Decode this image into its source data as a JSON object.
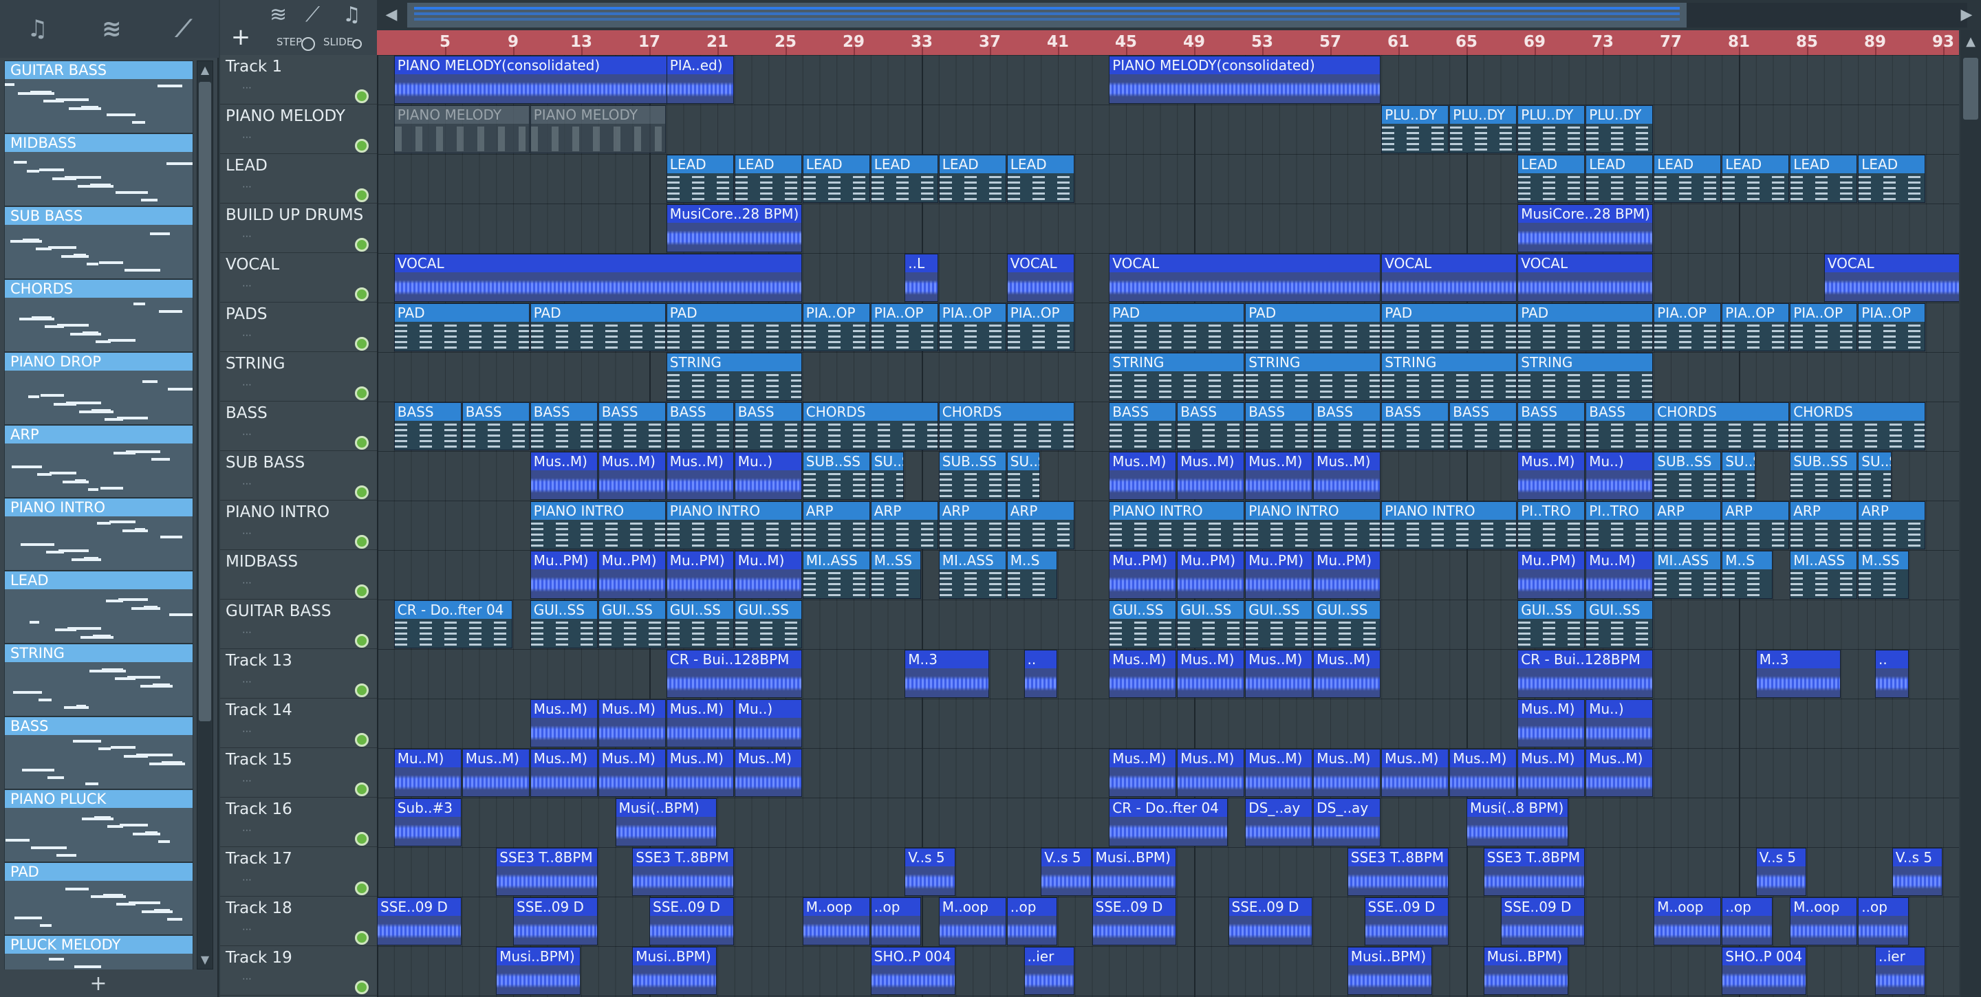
{
  "browser": {
    "icons": {
      "piano": "piano-roll-icon",
      "wave": "audio-clip-icon",
      "link": "automation-icon"
    },
    "add_label": "+",
    "clips": [
      "GUITAR BASS",
      "MIDBASS",
      "SUB BASS",
      "CHORDS",
      "PIANO DROP",
      "ARP",
      "PIANO INTRO",
      "LEAD",
      "STRING",
      "BASS",
      "PIANO PLUCK",
      "PAD",
      "PLUCK MELODY"
    ]
  },
  "toolbar": {
    "add_label": "+",
    "step_label": "STEP",
    "slide_label": "SLIDE"
  },
  "ruler": {
    "bars": [
      "5",
      "9",
      "13",
      "17",
      "21",
      "25",
      "29",
      "33",
      "37",
      "41",
      "45",
      "49",
      "53",
      "57",
      "61",
      "65",
      "69",
      "73",
      "77",
      "81",
      "85",
      "89",
      "93"
    ]
  },
  "tracks": [
    "Track 1",
    "PIANO MELODY",
    "LEAD",
    "BUILD UP DRUMS",
    "VOCAL",
    "PADS",
    "STRING",
    "BASS",
    "SUB BASS",
    "PIANO INTRO",
    "MIDBASS",
    "GUITAR BASS",
    "Track 13",
    "Track 14",
    "Track 15",
    "Track 16",
    "Track 17",
    "Track 18",
    "Track 19"
  ],
  "clips": [
    {
      "t": 0,
      "s": 1,
      "l": 20,
      "k": "a",
      "n": "PIANO MELODY(consolidated)"
    },
    {
      "t": 0,
      "s": 17,
      "l": 4,
      "k": "a",
      "n": "PIA..ed)"
    },
    {
      "t": 0,
      "s": 43,
      "l": 16,
      "k": "a",
      "n": "PIANO MELODY(consolidated)"
    },
    {
      "t": 1,
      "s": 1,
      "l": 8,
      "k": "m",
      "n": "PIANO MELODY"
    },
    {
      "t": 1,
      "s": 9,
      "l": 8,
      "k": "m",
      "n": "PIANO MELODY"
    },
    {
      "t": 1,
      "s": 59,
      "l": 4,
      "k": "p",
      "n": "PLU..DY"
    },
    {
      "t": 1,
      "s": 63,
      "l": 4,
      "k": "p",
      "n": "PLU..DY"
    },
    {
      "t": 1,
      "s": 67,
      "l": 4,
      "k": "p",
      "n": "PLU..DY"
    },
    {
      "t": 1,
      "s": 71,
      "l": 4,
      "k": "p",
      "n": "PLU..DY"
    },
    {
      "t": 2,
      "s": 17,
      "l": 4,
      "k": "p",
      "n": "LEAD"
    },
    {
      "t": 2,
      "s": 21,
      "l": 4,
      "k": "p",
      "n": "LEAD"
    },
    {
      "t": 2,
      "s": 25,
      "l": 4,
      "k": "p",
      "n": "LEAD"
    },
    {
      "t": 2,
      "s": 29,
      "l": 4,
      "k": "p",
      "n": "LEAD"
    },
    {
      "t": 2,
      "s": 33,
      "l": 4,
      "k": "p",
      "n": "LEAD"
    },
    {
      "t": 2,
      "s": 37,
      "l": 4,
      "k": "p",
      "n": "LEAD"
    },
    {
      "t": 2,
      "s": 67,
      "l": 4,
      "k": "p",
      "n": "LEAD"
    },
    {
      "t": 2,
      "s": 71,
      "l": 4,
      "k": "p",
      "n": "LEAD"
    },
    {
      "t": 2,
      "s": 75,
      "l": 4,
      "k": "p",
      "n": "LEAD"
    },
    {
      "t": 2,
      "s": 79,
      "l": 4,
      "k": "p",
      "n": "LEAD"
    },
    {
      "t": 2,
      "s": 83,
      "l": 4,
      "k": "p",
      "n": "LEAD"
    },
    {
      "t": 2,
      "s": 87,
      "l": 4,
      "k": "p",
      "n": "LEAD"
    },
    {
      "t": 3,
      "s": 17,
      "l": 8,
      "k": "a",
      "n": "MusiCore..28 BPM)"
    },
    {
      "t": 3,
      "s": 67,
      "l": 8,
      "k": "a",
      "n": "MusiCore..28 BPM)"
    },
    {
      "t": 4,
      "s": 1,
      "l": 24,
      "k": "a",
      "n": "VOCAL"
    },
    {
      "t": 4,
      "s": 31,
      "l": 2,
      "k": "a",
      "n": "..L"
    },
    {
      "t": 4,
      "s": 37,
      "l": 4,
      "k": "a",
      "n": "VOCAL"
    },
    {
      "t": 4,
      "s": 43,
      "l": 16,
      "k": "a",
      "n": "VOCAL"
    },
    {
      "t": 4,
      "s": 59,
      "l": 8,
      "k": "a",
      "n": "VOCAL"
    },
    {
      "t": 4,
      "s": 67,
      "l": 8,
      "k": "a",
      "n": "VOCAL"
    },
    {
      "t": 4,
      "s": 85,
      "l": 8,
      "k": "a",
      "n": "VOCAL"
    },
    {
      "t": 5,
      "s": 1,
      "l": 8,
      "k": "p",
      "n": "PAD"
    },
    {
      "t": 5,
      "s": 9,
      "l": 8,
      "k": "p",
      "n": "PAD"
    },
    {
      "t": 5,
      "s": 17,
      "l": 8,
      "k": "p",
      "n": "PAD"
    },
    {
      "t": 5,
      "s": 25,
      "l": 4,
      "k": "p",
      "n": "PIA..OP"
    },
    {
      "t": 5,
      "s": 29,
      "l": 4,
      "k": "p",
      "n": "PIA..OP"
    },
    {
      "t": 5,
      "s": 33,
      "l": 4,
      "k": "p",
      "n": "PIA..OP"
    },
    {
      "t": 5,
      "s": 37,
      "l": 4,
      "k": "p",
      "n": "PIA..OP"
    },
    {
      "t": 5,
      "s": 43,
      "l": 8,
      "k": "p",
      "n": "PAD"
    },
    {
      "t": 5,
      "s": 51,
      "l": 8,
      "k": "p",
      "n": "PAD"
    },
    {
      "t": 5,
      "s": 59,
      "l": 8,
      "k": "p",
      "n": "PAD"
    },
    {
      "t": 5,
      "s": 67,
      "l": 8,
      "k": "p",
      "n": "PAD"
    },
    {
      "t": 5,
      "s": 75,
      "l": 4,
      "k": "p",
      "n": "PIA..OP"
    },
    {
      "t": 5,
      "s": 79,
      "l": 4,
      "k": "p",
      "n": "PIA..OP"
    },
    {
      "t": 5,
      "s": 83,
      "l": 4,
      "k": "p",
      "n": "PIA..OP"
    },
    {
      "t": 5,
      "s": 87,
      "l": 4,
      "k": "p",
      "n": "PIA..OP"
    },
    {
      "t": 6,
      "s": 17,
      "l": 8,
      "k": "p",
      "n": "STRING"
    },
    {
      "t": 6,
      "s": 43,
      "l": 8,
      "k": "p",
      "n": "STRING"
    },
    {
      "t": 6,
      "s": 51,
      "l": 8,
      "k": "p",
      "n": "STRING"
    },
    {
      "t": 6,
      "s": 59,
      "l": 8,
      "k": "p",
      "n": "STRING"
    },
    {
      "t": 6,
      "s": 67,
      "l": 8,
      "k": "p",
      "n": "STRING"
    },
    {
      "t": 7,
      "s": 1,
      "l": 4,
      "k": "p",
      "n": "BASS"
    },
    {
      "t": 7,
      "s": 5,
      "l": 4,
      "k": "p",
      "n": "BASS"
    },
    {
      "t": 7,
      "s": 9,
      "l": 4,
      "k": "p",
      "n": "BASS"
    },
    {
      "t": 7,
      "s": 13,
      "l": 4,
      "k": "p",
      "n": "BASS"
    },
    {
      "t": 7,
      "s": 17,
      "l": 4,
      "k": "p",
      "n": "BASS"
    },
    {
      "t": 7,
      "s": 21,
      "l": 4,
      "k": "p",
      "n": "BASS"
    },
    {
      "t": 7,
      "s": 25,
      "l": 8,
      "k": "p",
      "n": "CHORDS"
    },
    {
      "t": 7,
      "s": 33,
      "l": 8,
      "k": "p",
      "n": "CHORDS"
    },
    {
      "t": 7,
      "s": 43,
      "l": 4,
      "k": "p",
      "n": "BASS"
    },
    {
      "t": 7,
      "s": 47,
      "l": 4,
      "k": "p",
      "n": "BASS"
    },
    {
      "t": 7,
      "s": 51,
      "l": 4,
      "k": "p",
      "n": "BASS"
    },
    {
      "t": 7,
      "s": 55,
      "l": 4,
      "k": "p",
      "n": "BASS"
    },
    {
      "t": 7,
      "s": 59,
      "l": 4,
      "k": "p",
      "n": "BASS"
    },
    {
      "t": 7,
      "s": 63,
      "l": 4,
      "k": "p",
      "n": "BASS"
    },
    {
      "t": 7,
      "s": 67,
      "l": 4,
      "k": "p",
      "n": "BASS"
    },
    {
      "t": 7,
      "s": 71,
      "l": 4,
      "k": "p",
      "n": "BASS"
    },
    {
      "t": 7,
      "s": 75,
      "l": 8,
      "k": "p",
      "n": "CHORDS"
    },
    {
      "t": 7,
      "s": 83,
      "l": 8,
      "k": "p",
      "n": "CHORDS"
    },
    {
      "t": 8,
      "s": 9,
      "l": 4,
      "k": "a",
      "n": "Mus..M)"
    },
    {
      "t": 8,
      "s": 13,
      "l": 4,
      "k": "a",
      "n": "Mus..M)"
    },
    {
      "t": 8,
      "s": 17,
      "l": 4,
      "k": "a",
      "n": "Mus..M)"
    },
    {
      "t": 8,
      "s": 21,
      "l": 4,
      "k": "a",
      "n": "Mu..)"
    },
    {
      "t": 8,
      "s": 25,
      "l": 4,
      "k": "p",
      "n": "SUB..SS"
    },
    {
      "t": 8,
      "s": 29,
      "l": 2,
      "k": "p",
      "n": "SU..S"
    },
    {
      "t": 8,
      "s": 33,
      "l": 4,
      "k": "p",
      "n": "SUB..SS"
    },
    {
      "t": 8,
      "s": 37,
      "l": 2,
      "k": "p",
      "n": "SU..S"
    },
    {
      "t": 8,
      "s": 43,
      "l": 4,
      "k": "a",
      "n": "Mus..M)"
    },
    {
      "t": 8,
      "s": 47,
      "l": 4,
      "k": "a",
      "n": "Mus..M)"
    },
    {
      "t": 8,
      "s": 51,
      "l": 4,
      "k": "a",
      "n": "Mus..M)"
    },
    {
      "t": 8,
      "s": 55,
      "l": 4,
      "k": "a",
      "n": "Mus..M)"
    },
    {
      "t": 8,
      "s": 67,
      "l": 4,
      "k": "a",
      "n": "Mus..M)"
    },
    {
      "t": 8,
      "s": 71,
      "l": 4,
      "k": "a",
      "n": "Mu..)"
    },
    {
      "t": 8,
      "s": 75,
      "l": 4,
      "k": "p",
      "n": "SUB..SS"
    },
    {
      "t": 8,
      "s": 79,
      "l": 2,
      "k": "p",
      "n": "SU..S"
    },
    {
      "t": 8,
      "s": 83,
      "l": 4,
      "k": "p",
      "n": "SUB..SS"
    },
    {
      "t": 8,
      "s": 87,
      "l": 2,
      "k": "p",
      "n": "SU..S"
    },
    {
      "t": 9,
      "s": 9,
      "l": 8,
      "k": "p",
      "n": "PIANO INTRO"
    },
    {
      "t": 9,
      "s": 17,
      "l": 8,
      "k": "p",
      "n": "PIANO INTRO"
    },
    {
      "t": 9,
      "s": 25,
      "l": 4,
      "k": "p",
      "n": "ARP"
    },
    {
      "t": 9,
      "s": 29,
      "l": 4,
      "k": "p",
      "n": "ARP"
    },
    {
      "t": 9,
      "s": 33,
      "l": 4,
      "k": "p",
      "n": "ARP"
    },
    {
      "t": 9,
      "s": 37,
      "l": 4,
      "k": "p",
      "n": "ARP"
    },
    {
      "t": 9,
      "s": 43,
      "l": 8,
      "k": "p",
      "n": "PIANO INTRO"
    },
    {
      "t": 9,
      "s": 51,
      "l": 8,
      "k": "p",
      "n": "PIANO INTRO"
    },
    {
      "t": 9,
      "s": 59,
      "l": 8,
      "k": "p",
      "n": "PIANO INTRO"
    },
    {
      "t": 9,
      "s": 67,
      "l": 4,
      "k": "p",
      "n": "PI..TRO"
    },
    {
      "t": 9,
      "s": 71,
      "l": 4,
      "k": "p",
      "n": "PI..TRO"
    },
    {
      "t": 9,
      "s": 75,
      "l": 4,
      "k": "p",
      "n": "ARP"
    },
    {
      "t": 9,
      "s": 79,
      "l": 4,
      "k": "p",
      "n": "ARP"
    },
    {
      "t": 9,
      "s": 83,
      "l": 4,
      "k": "p",
      "n": "ARP"
    },
    {
      "t": 9,
      "s": 87,
      "l": 4,
      "k": "p",
      "n": "ARP"
    },
    {
      "t": 10,
      "s": 9,
      "l": 4,
      "k": "a",
      "n": "Mu..PM)"
    },
    {
      "t": 10,
      "s": 13,
      "l": 4,
      "k": "a",
      "n": "Mu..PM)"
    },
    {
      "t": 10,
      "s": 17,
      "l": 4,
      "k": "a",
      "n": "Mu..PM)"
    },
    {
      "t": 10,
      "s": 21,
      "l": 4,
      "k": "a",
      "n": "Mu..M)"
    },
    {
      "t": 10,
      "s": 25,
      "l": 4,
      "k": "p",
      "n": "MI..ASS"
    },
    {
      "t": 10,
      "s": 29,
      "l": 3,
      "k": "p",
      "n": "M..SS"
    },
    {
      "t": 10,
      "s": 33,
      "l": 4,
      "k": "p",
      "n": "MI..ASS"
    },
    {
      "t": 10,
      "s": 37,
      "l": 3,
      "k": "p",
      "n": "M..S"
    },
    {
      "t": 10,
      "s": 43,
      "l": 4,
      "k": "a",
      "n": "Mu..PM)"
    },
    {
      "t": 10,
      "s": 47,
      "l": 4,
      "k": "a",
      "n": "Mu..PM)"
    },
    {
      "t": 10,
      "s": 51,
      "l": 4,
      "k": "a",
      "n": "Mu..PM)"
    },
    {
      "t": 10,
      "s": 55,
      "l": 4,
      "k": "a",
      "n": "Mu..PM)"
    },
    {
      "t": 10,
      "s": 67,
      "l": 4,
      "k": "a",
      "n": "Mu..PM)"
    },
    {
      "t": 10,
      "s": 71,
      "l": 4,
      "k": "a",
      "n": "Mu..M)"
    },
    {
      "t": 10,
      "s": 75,
      "l": 4,
      "k": "p",
      "n": "MI..ASS"
    },
    {
      "t": 10,
      "s": 79,
      "l": 3,
      "k": "p",
      "n": "M..S"
    },
    {
      "t": 10,
      "s": 83,
      "l": 4,
      "k": "p",
      "n": "MI..ASS"
    },
    {
      "t": 10,
      "s": 87,
      "l": 3,
      "k": "p",
      "n": "M..SS"
    },
    {
      "t": 11,
      "s": 1,
      "l": 7,
      "k": "p",
      "n": "CR - Do..fter 04"
    },
    {
      "t": 11,
      "s": 9,
      "l": 4,
      "k": "p",
      "n": "GUI..SS"
    },
    {
      "t": 11,
      "s": 13,
      "l": 4,
      "k": "p",
      "n": "GUI..SS"
    },
    {
      "t": 11,
      "s": 17,
      "l": 4,
      "k": "p",
      "n": "GUI..SS"
    },
    {
      "t": 11,
      "s": 21,
      "l": 4,
      "k": "p",
      "n": "GUI..SS"
    },
    {
      "t": 11,
      "s": 43,
      "l": 4,
      "k": "p",
      "n": "GUI..SS"
    },
    {
      "t": 11,
      "s": 47,
      "l": 4,
      "k": "p",
      "n": "GUI..SS"
    },
    {
      "t": 11,
      "s": 51,
      "l": 4,
      "k": "p",
      "n": "GUI..SS"
    },
    {
      "t": 11,
      "s": 55,
      "l": 4,
      "k": "p",
      "n": "GUI..SS"
    },
    {
      "t": 11,
      "s": 67,
      "l": 4,
      "k": "p",
      "n": "GUI..SS"
    },
    {
      "t": 11,
      "s": 71,
      "l": 4,
      "k": "p",
      "n": "GUI..SS"
    },
    {
      "t": 12,
      "s": 17,
      "l": 8,
      "k": "a",
      "n": "CR - Bui..128BPM"
    },
    {
      "t": 12,
      "s": 31,
      "l": 5,
      "k": "a",
      "n": "M..3"
    },
    {
      "t": 12,
      "s": 38,
      "l": 2,
      "k": "a",
      "n": ".."
    },
    {
      "t": 12,
      "s": 43,
      "l": 4,
      "k": "a",
      "n": "Mus..M)"
    },
    {
      "t": 12,
      "s": 47,
      "l": 4,
      "k": "a",
      "n": "Mus..M)"
    },
    {
      "t": 12,
      "s": 51,
      "l": 4,
      "k": "a",
      "n": "Mus..M)"
    },
    {
      "t": 12,
      "s": 55,
      "l": 4,
      "k": "a",
      "n": "Mus..M)"
    },
    {
      "t": 12,
      "s": 67,
      "l": 8,
      "k": "a",
      "n": "CR - Bui..128BPM"
    },
    {
      "t": 12,
      "s": 81,
      "l": 5,
      "k": "a",
      "n": "M..3"
    },
    {
      "t": 12,
      "s": 88,
      "l": 2,
      "k": "a",
      "n": ".."
    },
    {
      "t": 13,
      "s": 9,
      "l": 4,
      "k": "a",
      "n": "Mus..M)"
    },
    {
      "t": 13,
      "s": 13,
      "l": 4,
      "k": "a",
      "n": "Mus..M)"
    },
    {
      "t": 13,
      "s": 17,
      "l": 4,
      "k": "a",
      "n": "Mus..M)"
    },
    {
      "t": 13,
      "s": 21,
      "l": 4,
      "k": "a",
      "n": "Mu..)"
    },
    {
      "t": 13,
      "s": 67,
      "l": 4,
      "k": "a",
      "n": "Mus..M)"
    },
    {
      "t": 13,
      "s": 71,
      "l": 4,
      "k": "a",
      "n": "Mu..)"
    },
    {
      "t": 14,
      "s": 1,
      "l": 4,
      "k": "a",
      "n": "Mu..M)"
    },
    {
      "t": 14,
      "s": 5,
      "l": 4,
      "k": "a",
      "n": "Mus..M)"
    },
    {
      "t": 14,
      "s": 9,
      "l": 4,
      "k": "a",
      "n": "Mus..M)"
    },
    {
      "t": 14,
      "s": 13,
      "l": 4,
      "k": "a",
      "n": "Mus..M)"
    },
    {
      "t": 14,
      "s": 17,
      "l": 4,
      "k": "a",
      "n": "Mus..M)"
    },
    {
      "t": 14,
      "s": 21,
      "l": 4,
      "k": "a",
      "n": "Mus..M)"
    },
    {
      "t": 14,
      "s": 43,
      "l": 4,
      "k": "a",
      "n": "Mus..M)"
    },
    {
      "t": 14,
      "s": 47,
      "l": 4,
      "k": "a",
      "n": "Mus..M)"
    },
    {
      "t": 14,
      "s": 51,
      "l": 4,
      "k": "a",
      "n": "Mus..M)"
    },
    {
      "t": 14,
      "s": 55,
      "l": 4,
      "k": "a",
      "n": "Mus..M)"
    },
    {
      "t": 14,
      "s": 59,
      "l": 4,
      "k": "a",
      "n": "Mus..M)"
    },
    {
      "t": 14,
      "s": 63,
      "l": 4,
      "k": "a",
      "n": "Mus..M)"
    },
    {
      "t": 14,
      "s": 67,
      "l": 4,
      "k": "a",
      "n": "Mus..M)"
    },
    {
      "t": 14,
      "s": 71,
      "l": 4,
      "k": "a",
      "n": "Mus..M)"
    },
    {
      "t": 15,
      "s": 1,
      "l": 4,
      "k": "a",
      "n": "Sub..#3"
    },
    {
      "t": 15,
      "s": 14,
      "l": 6,
      "k": "a",
      "n": "Musi(..BPM)"
    },
    {
      "t": 15,
      "s": 43,
      "l": 7,
      "k": "a",
      "n": "CR - Do..fter 04"
    },
    {
      "t": 15,
      "s": 51,
      "l": 4,
      "k": "a",
      "n": "DS_..ay"
    },
    {
      "t": 15,
      "s": 55,
      "l": 4,
      "k": "a",
      "n": "DS_..ay"
    },
    {
      "t": 15,
      "s": 64,
      "l": 6,
      "k": "a",
      "n": "Musi(..8 BPM)"
    },
    {
      "t": 16,
      "s": 7,
      "l": 6,
      "k": "a",
      "n": "SSE3 T..8BPM"
    },
    {
      "t": 16,
      "s": 15,
      "l": 6,
      "k": "a",
      "n": "SSE3 T..8BPM"
    },
    {
      "t": 16,
      "s": 31,
      "l": 3,
      "k": "a",
      "n": "V..s 5"
    },
    {
      "t": 16,
      "s": 39,
      "l": 3,
      "k": "a",
      "n": "V..s 5"
    },
    {
      "t": 16,
      "s": 42,
      "l": 5,
      "k": "a",
      "n": "Musi..BPM)"
    },
    {
      "t": 16,
      "s": 57,
      "l": 6,
      "k": "a",
      "n": "SSE3 T..8BPM"
    },
    {
      "t": 16,
      "s": 65,
      "l": 6,
      "k": "a",
      "n": "SSE3 T..8BPM"
    },
    {
      "t": 16,
      "s": 81,
      "l": 3,
      "k": "a",
      "n": "V..s 5"
    },
    {
      "t": 16,
      "s": 89,
      "l": 3,
      "k": "a",
      "n": "V..s 5"
    },
    {
      "t": 17,
      "s": 0,
      "l": 5,
      "k": "a",
      "n": "SSE..09 D"
    },
    {
      "t": 17,
      "s": 8,
      "l": 5,
      "k": "a",
      "n": "SSE..09 D"
    },
    {
      "t": 17,
      "s": 16,
      "l": 5,
      "k": "a",
      "n": "SSE..09 D"
    },
    {
      "t": 17,
      "s": 25,
      "l": 4,
      "k": "a",
      "n": "M..oop"
    },
    {
      "t": 17,
      "s": 29,
      "l": 3,
      "k": "a",
      "n": "..op"
    },
    {
      "t": 17,
      "s": 33,
      "l": 4,
      "k": "a",
      "n": "M..oop"
    },
    {
      "t": 17,
      "s": 37,
      "l": 3,
      "k": "a",
      "n": "..op"
    },
    {
      "t": 17,
      "s": 42,
      "l": 5,
      "k": "a",
      "n": "SSE..09 D"
    },
    {
      "t": 17,
      "s": 50,
      "l": 5,
      "k": "a",
      "n": "SSE..09 D"
    },
    {
      "t": 17,
      "s": 58,
      "l": 5,
      "k": "a",
      "n": "SSE..09 D"
    },
    {
      "t": 17,
      "s": 66,
      "l": 5,
      "k": "a",
      "n": "SSE..09 D"
    },
    {
      "t": 17,
      "s": 75,
      "l": 4,
      "k": "a",
      "n": "M..oop"
    },
    {
      "t": 17,
      "s": 79,
      "l": 3,
      "k": "a",
      "n": "..op"
    },
    {
      "t": 17,
      "s": 83,
      "l": 4,
      "k": "a",
      "n": "M..oop"
    },
    {
      "t": 17,
      "s": 87,
      "l": 3,
      "k": "a",
      "n": "..op"
    },
    {
      "t": 18,
      "s": 7,
      "l": 5,
      "k": "a",
      "n": "Musi..BPM)"
    },
    {
      "t": 18,
      "s": 15,
      "l": 5,
      "k": "a",
      "n": "Musi..BPM)"
    },
    {
      "t": 18,
      "s": 29,
      "l": 5,
      "k": "a",
      "n": "SHO..P 004"
    },
    {
      "t": 18,
      "s": 38,
      "l": 3,
      "k": "a",
      "n": "..ier"
    },
    {
      "t": 18,
      "s": 57,
      "l": 5,
      "k": "a",
      "n": "Musi..BPM)"
    },
    {
      "t": 18,
      "s": 65,
      "l": 5,
      "k": "a",
      "n": "Musi..BPM)"
    },
    {
      "t": 18,
      "s": 79,
      "l": 5,
      "k": "a",
      "n": "SHO..P 004"
    },
    {
      "t": 18,
      "s": 88,
      "l": 3,
      "k": "a",
      "n": "..ier"
    }
  ]
}
